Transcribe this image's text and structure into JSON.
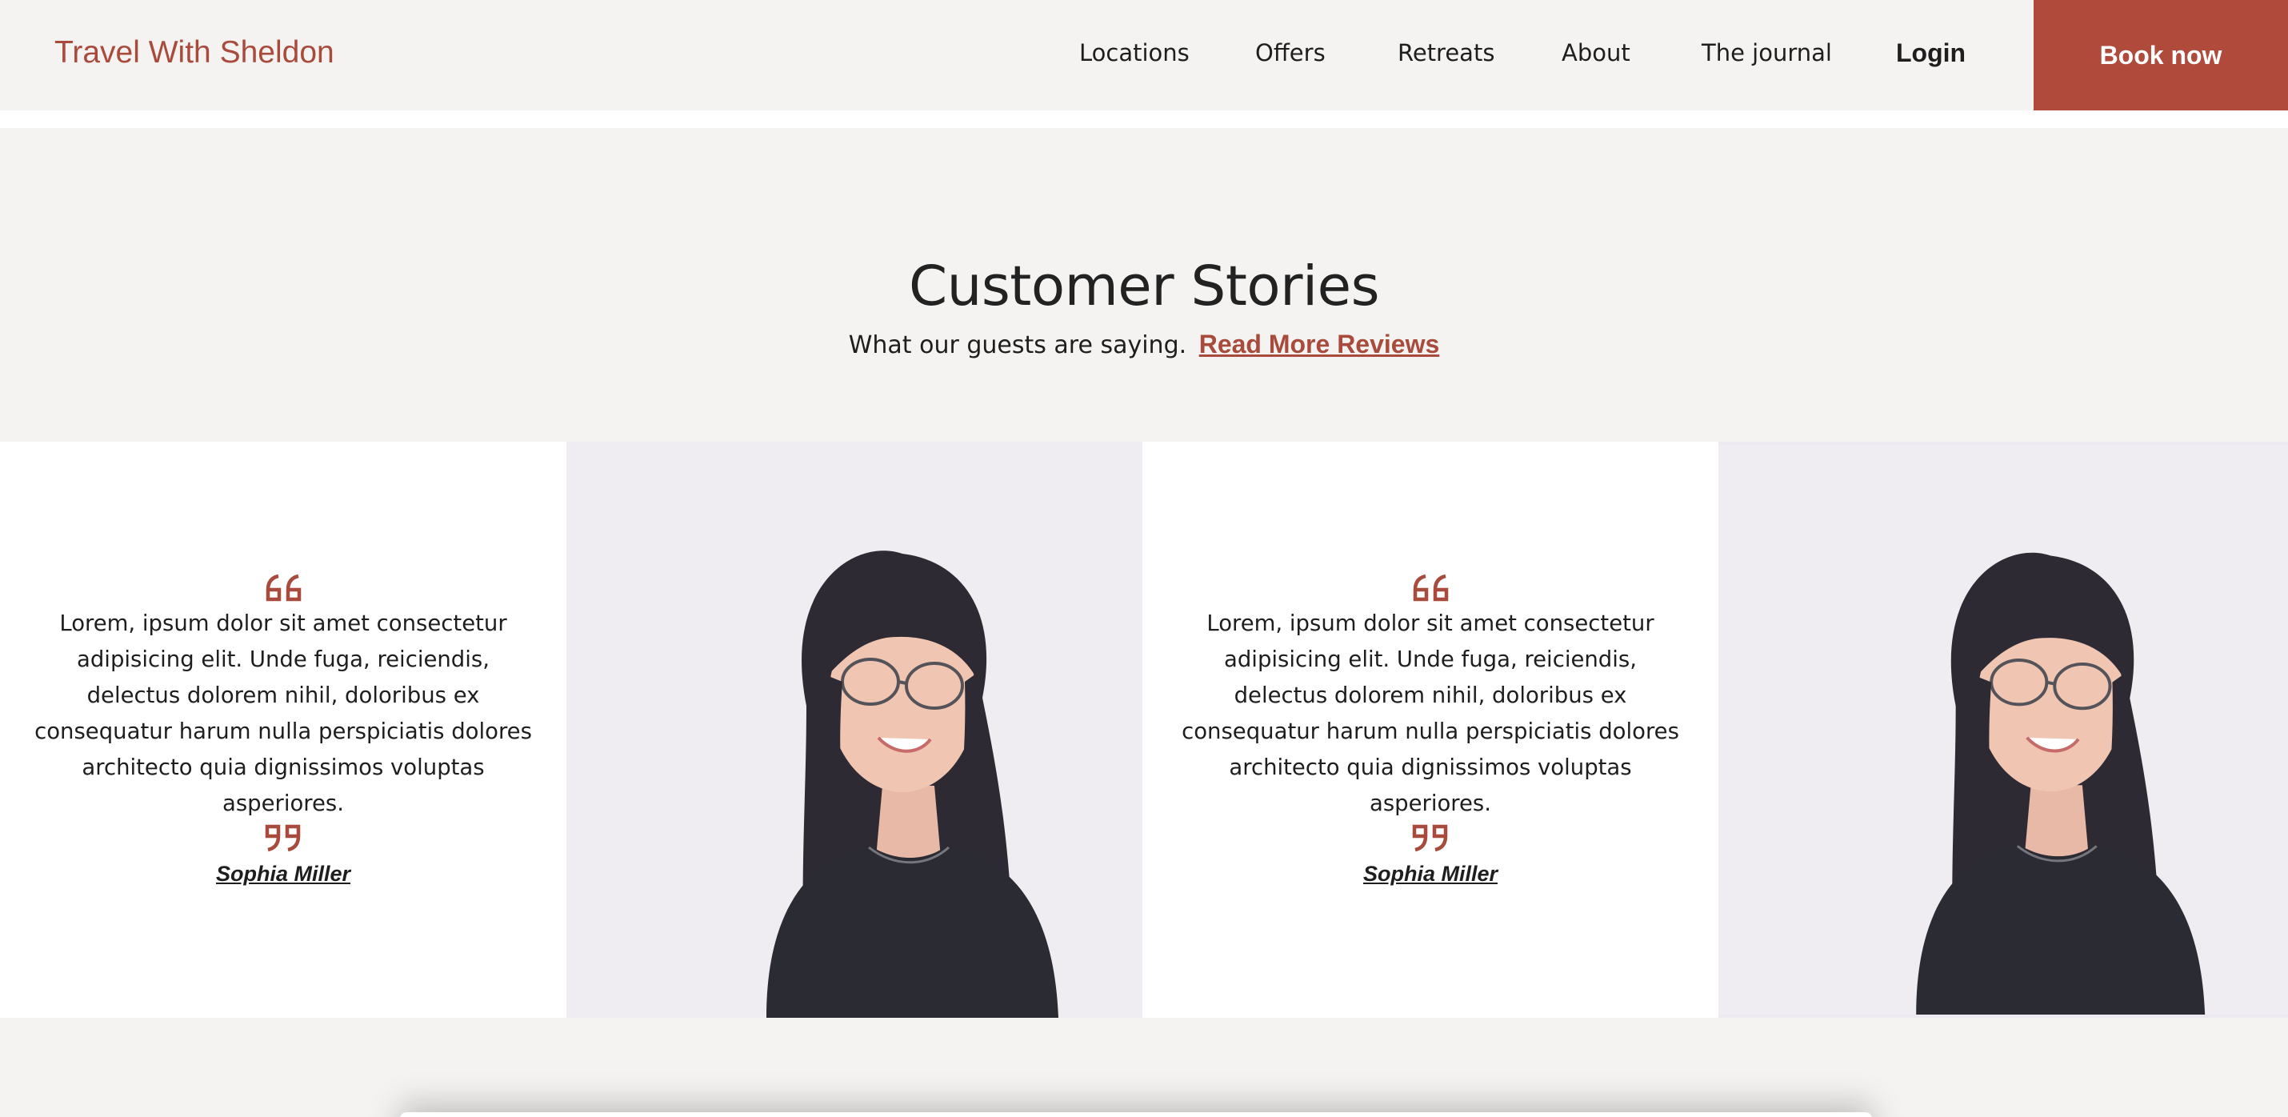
{
  "header": {
    "brand": "Travel With Sheldon",
    "nav": [
      "Locations",
      "Offers",
      "Retreats",
      "About",
      "The journal"
    ],
    "login_label": "Login",
    "book_label": "Book now"
  },
  "hero": {
    "title": "Customer Stories",
    "subtitle": "What our guests are saying.",
    "link_label": "Read More Reviews"
  },
  "testimonials": [
    {
      "quote": "Lorem, ipsum dolor sit amet consectetur adipisicing elit. Unde fuga, reiciendis, delectus dolorem nihil, doloribus ex consequatur harum nulla perspiciatis dolores architecto quia dignissimos voluptas asperiores.",
      "author": "Sophia Miller"
    },
    {
      "quote": "Lorem, ipsum dolor sit amet consectetur adipisicing elit. Unde fuga, reiciendis, delectus dolorem nihil, doloribus ex consequatur harum nulla perspiciatis dolores architecto quia dignissimos voluptas asperiores.",
      "author": "Sophia Miller"
    }
  ],
  "colors": {
    "accent": "#b04a3b",
    "brand_text": "#a84b3c",
    "section_bg": "#f4f3f1",
    "text": "#1e1e1e"
  }
}
